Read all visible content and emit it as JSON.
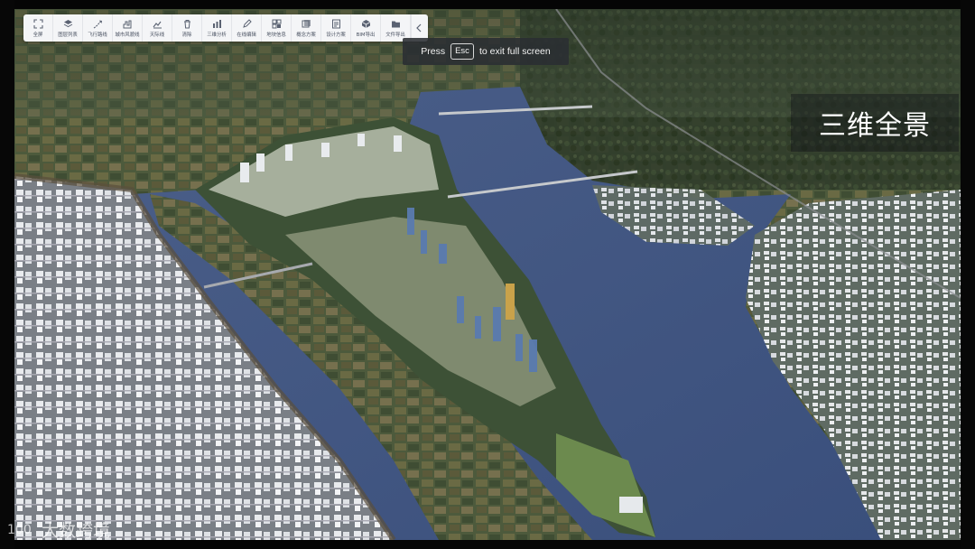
{
  "toolbar": {
    "items": [
      {
        "label": "全屏",
        "icon": "fullscreen-icon"
      },
      {
        "label": "图层列表",
        "icon": "layers-icon"
      },
      {
        "label": "飞行路线",
        "icon": "flight-route-icon"
      },
      {
        "label": "城市风貌线",
        "icon": "cityscape-line-icon"
      },
      {
        "label": "天际线",
        "icon": "skyline-icon"
      },
      {
        "label": "清除",
        "icon": "trash-icon"
      },
      {
        "label": "三维分析",
        "icon": "3d-analysis-icon"
      },
      {
        "label": "在线编辑",
        "icon": "edit-icon"
      },
      {
        "label": "地块信息",
        "icon": "parcel-info-icon"
      },
      {
        "label": "概念方案",
        "icon": "concept-plan-icon"
      },
      {
        "label": "设计方案",
        "icon": "design-plan-icon"
      },
      {
        "label": "BIM导出",
        "icon": "bim-export-icon"
      },
      {
        "label": "文件导出",
        "icon": "folder-icon"
      }
    ],
    "collapse_icon": "chevron-left-icon"
  },
  "fullscreen_hint": {
    "before": "Press",
    "key": "Esc",
    "after": "to exit full screen"
  },
  "scene_title": "三维全景",
  "watermark": {
    "text": "大数跨境",
    "logo_text": "100"
  },
  "colors": {
    "river": "#3f5684",
    "toolbar_bg": "#f4f5f7",
    "toolbar_text": "#4a5262",
    "hint_bg": "#2a2d32"
  }
}
